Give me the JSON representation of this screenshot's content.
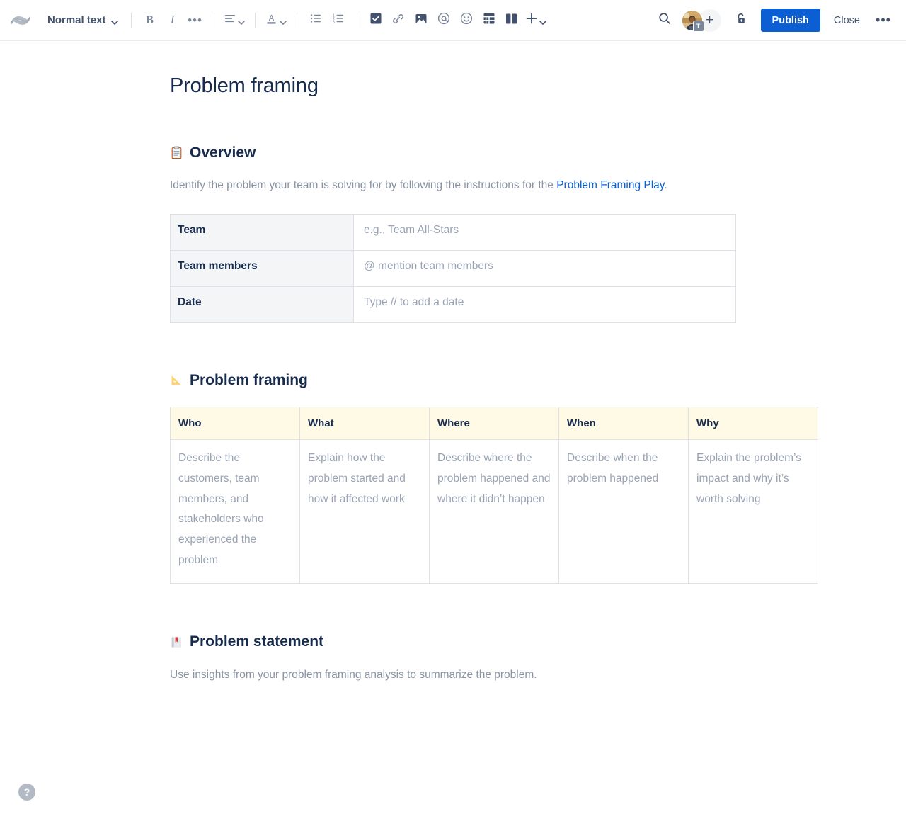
{
  "toolbar": {
    "logo_name": "confluence-logo",
    "text_style": {
      "label": "Normal text"
    },
    "bold_label": "B",
    "italic_label": "I",
    "more_formatting_label": "•••",
    "publish_label": "Publish",
    "close_label": "Close",
    "page_more_label": "•••",
    "add_person_label": "+",
    "avatar_badge_label": "T",
    "insert_plus_label": "+",
    "accent_color": "#0c5fd3",
    "icons": [
      "text-style-chevron-icon",
      "bold-icon",
      "italic-icon",
      "more-formatting-icon",
      "text-align-icon",
      "text-color-icon",
      "bullet-list-icon",
      "numbered-list-icon",
      "action-item-icon",
      "link-icon",
      "image-icon",
      "mention-icon",
      "emoji-icon",
      "table-icon",
      "layouts-icon",
      "insert-more-icon",
      "search-icon",
      "restrictions-icon"
    ]
  },
  "document": {
    "title": "Problem framing",
    "sections": [
      {
        "emoji": "clipboard",
        "heading": "Overview",
        "paragraph_before_link": "Identify the problem your team is solving for by following the instructions for the ",
        "link_text": "Problem Framing Play",
        "paragraph_after_link": "."
      },
      {
        "emoji": "triangular-ruler",
        "heading": "Problem framing"
      },
      {
        "emoji": "closed-book",
        "heading": "Problem statement",
        "paragraph": "Use insights from your problem framing analysis to summarize the problem."
      }
    ],
    "overview_table": {
      "rows": [
        {
          "label": "Team",
          "value": "e.g., Team All-Stars"
        },
        {
          "label": "Team members",
          "value": "@ mention team members"
        },
        {
          "label": "Date",
          "value": "Type // to add a date"
        }
      ]
    },
    "framing_table": {
      "headers": [
        "Who",
        "What",
        "Where",
        "When",
        "Why"
      ],
      "row": [
        "Describe the customers, team members, and stakeholders who experienced the problem",
        "Explain how the problem started and how it affected work",
        "Describe where the problem happened and where it didn’t happen",
        "Describe when the problem happened",
        "Explain the problem’s impact and why it’s worth solving"
      ]
    }
  },
  "help": {
    "label": "?"
  }
}
